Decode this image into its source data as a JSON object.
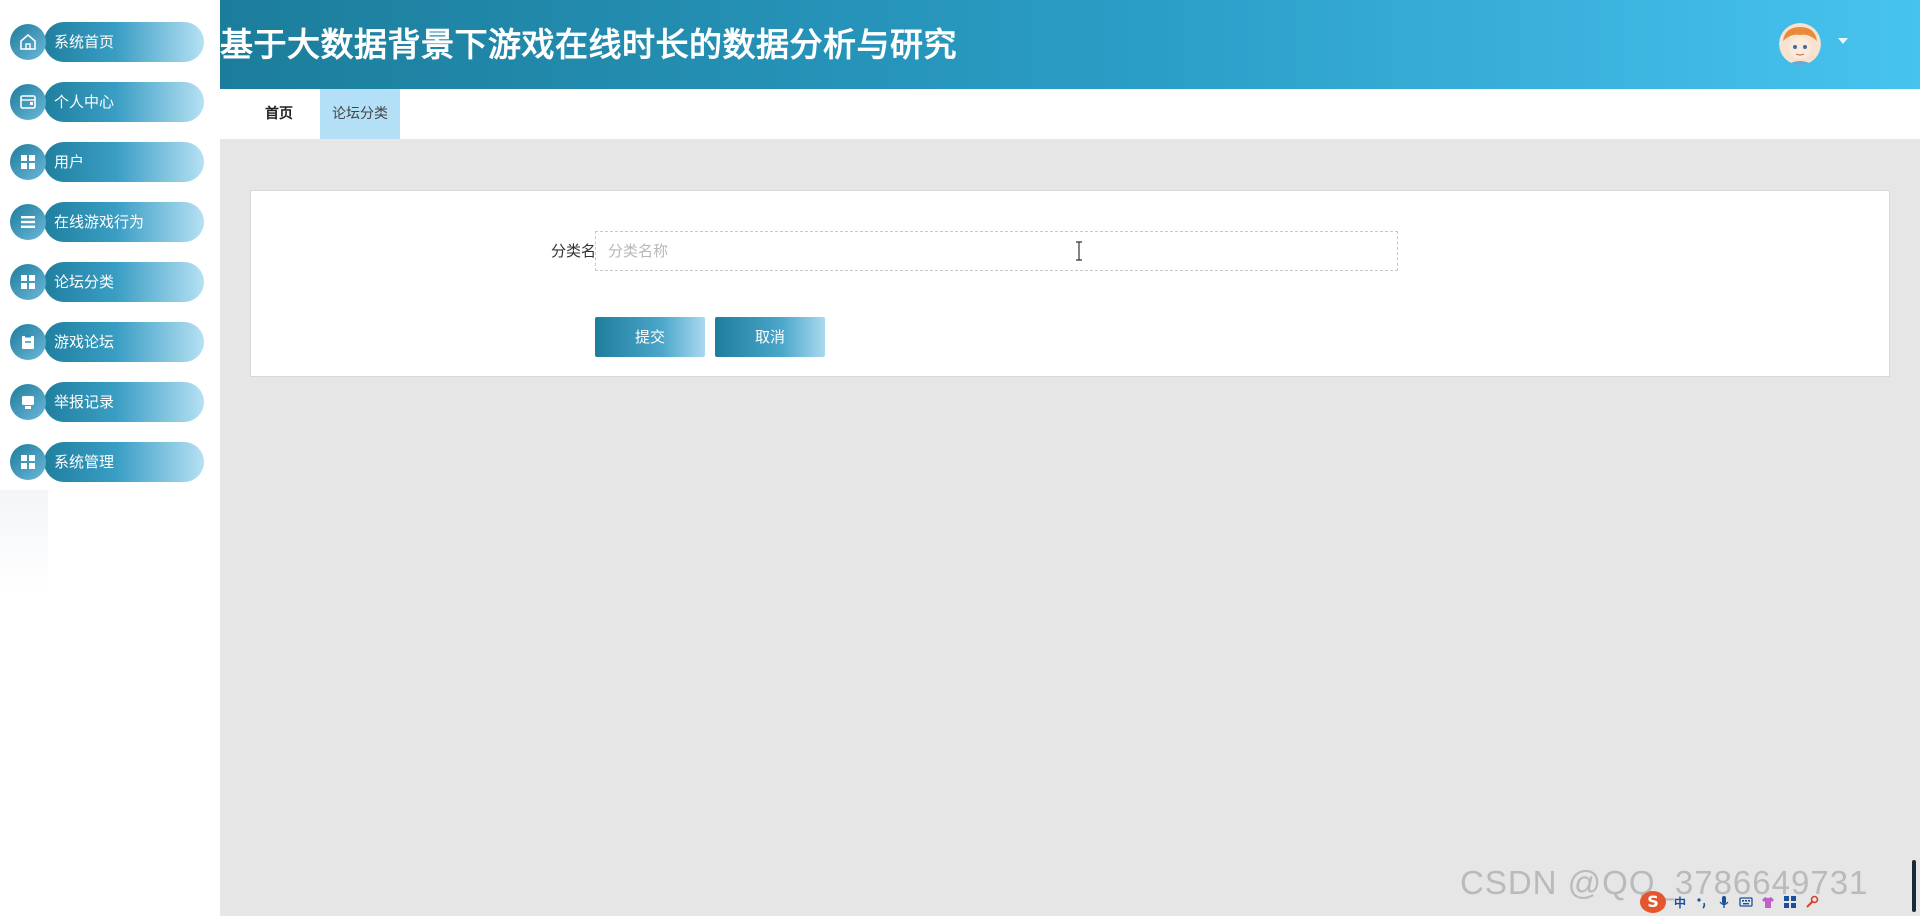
{
  "header": {
    "title": "基于大数据背景下游戏在线时长的数据分析与研究",
    "avatar_icon": "user-avatar",
    "caret_icon": "caret-down-icon",
    "colors": {
      "gradient_start": "#1c7d9b",
      "gradient_end": "#47c3ef"
    }
  },
  "sidebar": {
    "items": [
      {
        "label": "系统首页",
        "icon": "home-icon"
      },
      {
        "label": "个人中心",
        "icon": "wallet-icon"
      },
      {
        "label": "用户",
        "icon": "grid-icon"
      },
      {
        "label": "在线游戏行为",
        "icon": "list-icon"
      },
      {
        "label": "论坛分类",
        "icon": "grid-icon"
      },
      {
        "label": "游戏论坛",
        "icon": "clipboard-icon"
      },
      {
        "label": "举报记录",
        "icon": "monitor-icon"
      },
      {
        "label": "系统管理",
        "icon": "grid-icon"
      }
    ]
  },
  "tabs": {
    "home": "首页",
    "active": "论坛分类",
    "active_color": "#b4e0f7"
  },
  "form": {
    "label": "分类名称",
    "input_value": "",
    "placeholder": "分类名称",
    "submit_label": "提交",
    "cancel_label": "取消"
  },
  "watermark": "CSDN @QQ_3786649731",
  "tray": {
    "logo": "S",
    "ime_label": "中",
    "items": [
      "punctuation-icon",
      "microphone-icon",
      "keyboard-icon",
      "shirt-icon",
      "apps-icon",
      "tools-icon"
    ]
  }
}
